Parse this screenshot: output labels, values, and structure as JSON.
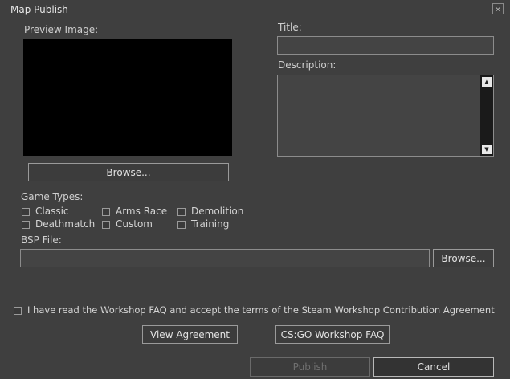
{
  "window": {
    "title": "Map Publish",
    "close_icon": "×"
  },
  "preview": {
    "label": "Preview Image:",
    "browse_label": "Browse..."
  },
  "title_field": {
    "label": "Title:",
    "value": ""
  },
  "description_field": {
    "label": "Description:",
    "value": ""
  },
  "scrollbar": {
    "up_icon": "▲",
    "down_icon": "▼"
  },
  "game_types": {
    "label": "Game Types:",
    "items": [
      "Classic",
      "Arms Race",
      "Demolition",
      "Deathmatch",
      "Custom",
      "Training"
    ]
  },
  "bsp": {
    "label": "BSP File:",
    "value": "",
    "browse_label": "Browse..."
  },
  "agreement": {
    "text": "I have read the Workshop FAQ and accept the terms of the Steam Workshop Contribution Agreement",
    "view_label": "View Agreement",
    "faq_label": "CS:GO Workshop FAQ"
  },
  "actions": {
    "publish_label": "Publish",
    "cancel_label": "Cancel"
  },
  "colors": {
    "background": "#3f3f3f",
    "disabled_text": "#6f6f6f"
  }
}
